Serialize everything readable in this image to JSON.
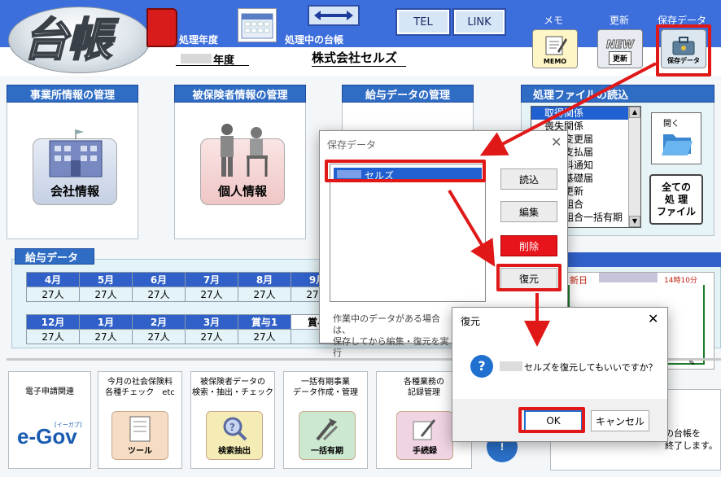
{
  "header": {
    "logo_text": "台帳",
    "processing_year_label": "処理年度",
    "processing_ledger_label": "処理中の台帳",
    "year_suffix": "年度",
    "company_name": "株式会社セルズ",
    "tel_button": "TEL",
    "link_button": "LINK",
    "memo_label": "メモ",
    "memo_icon_text": "MEMO",
    "update_label": "更新",
    "update_icon_new": "NEW",
    "update_icon_text": "更新",
    "save_data_label": "保存データ",
    "save_data_icon_text": "保存データ"
  },
  "panels": {
    "office": {
      "title": "事業所情報の管理",
      "button": "会社情報"
    },
    "insured": {
      "title": "被保険者情報の管理",
      "button": "個人情報"
    },
    "salary_mgmt": {
      "title": "給与データの管理"
    },
    "file_read": {
      "title": "処理ファイルの読込",
      "list_items": [
        "取得関係",
        "喪失関係",
        "変更届",
        "支払届",
        "料通知",
        "基礎届",
        "更新",
        "組合",
        "組合一括有期"
      ],
      "open_button": "開く",
      "all_files_button": "全ての\n処 理\nファイル"
    }
  },
  "salary_data": {
    "title": "給与データ",
    "row1_months": [
      "4月",
      "5月",
      "6月",
      "7月",
      "8月",
      "9月"
    ],
    "row1_values": [
      "27人",
      "27人",
      "27人",
      "27人",
      "27人",
      "27人"
    ],
    "row2_months": [
      "12月",
      "1月",
      "2月",
      "3月",
      "賞与1",
      "賞与"
    ],
    "row2_values": [
      "27人",
      "27人",
      "27人",
      "27人",
      "27人",
      ""
    ]
  },
  "right_status": {
    "update_date_label": "新日",
    "time": "14時10分"
  },
  "bottom": {
    "e_filing": {
      "title": "電子申請関連",
      "logo": "e-Gov",
      "logo_sub": "[イーガブ]"
    },
    "monthly_check": {
      "title": "今月の社会保険料\n各種チェック　etc",
      "button": "ツール"
    },
    "insured_search": {
      "title": "被保険者データの\n検索・抽出・チェック",
      "button": "検索抽出"
    },
    "lump_sum": {
      "title": "一括有期事業\nデータ作成・管理",
      "button": "一括有期"
    },
    "records": {
      "title": "各種業務の\n記録管理",
      "button": "手続録"
    },
    "exit_text": "の台帳を\n終了します。"
  },
  "save_dialog": {
    "title": "保存データ",
    "list_item": "セルズ",
    "read_button": "読込",
    "edit_button": "編集",
    "delete_button": "削除",
    "restore_button": "復元",
    "note": "作業中のデータがある場合は、\n保存してから編集・復元を実行"
  },
  "restore_dialog": {
    "title": "復元",
    "message": "セルズを復元してもいいですか？",
    "ok_button": "OK",
    "cancel_button": "キャンセル"
  },
  "colors": {
    "accent_blue": "#3c6edc",
    "highlight_red": "#e01818",
    "delete_red": "#e8141c"
  }
}
